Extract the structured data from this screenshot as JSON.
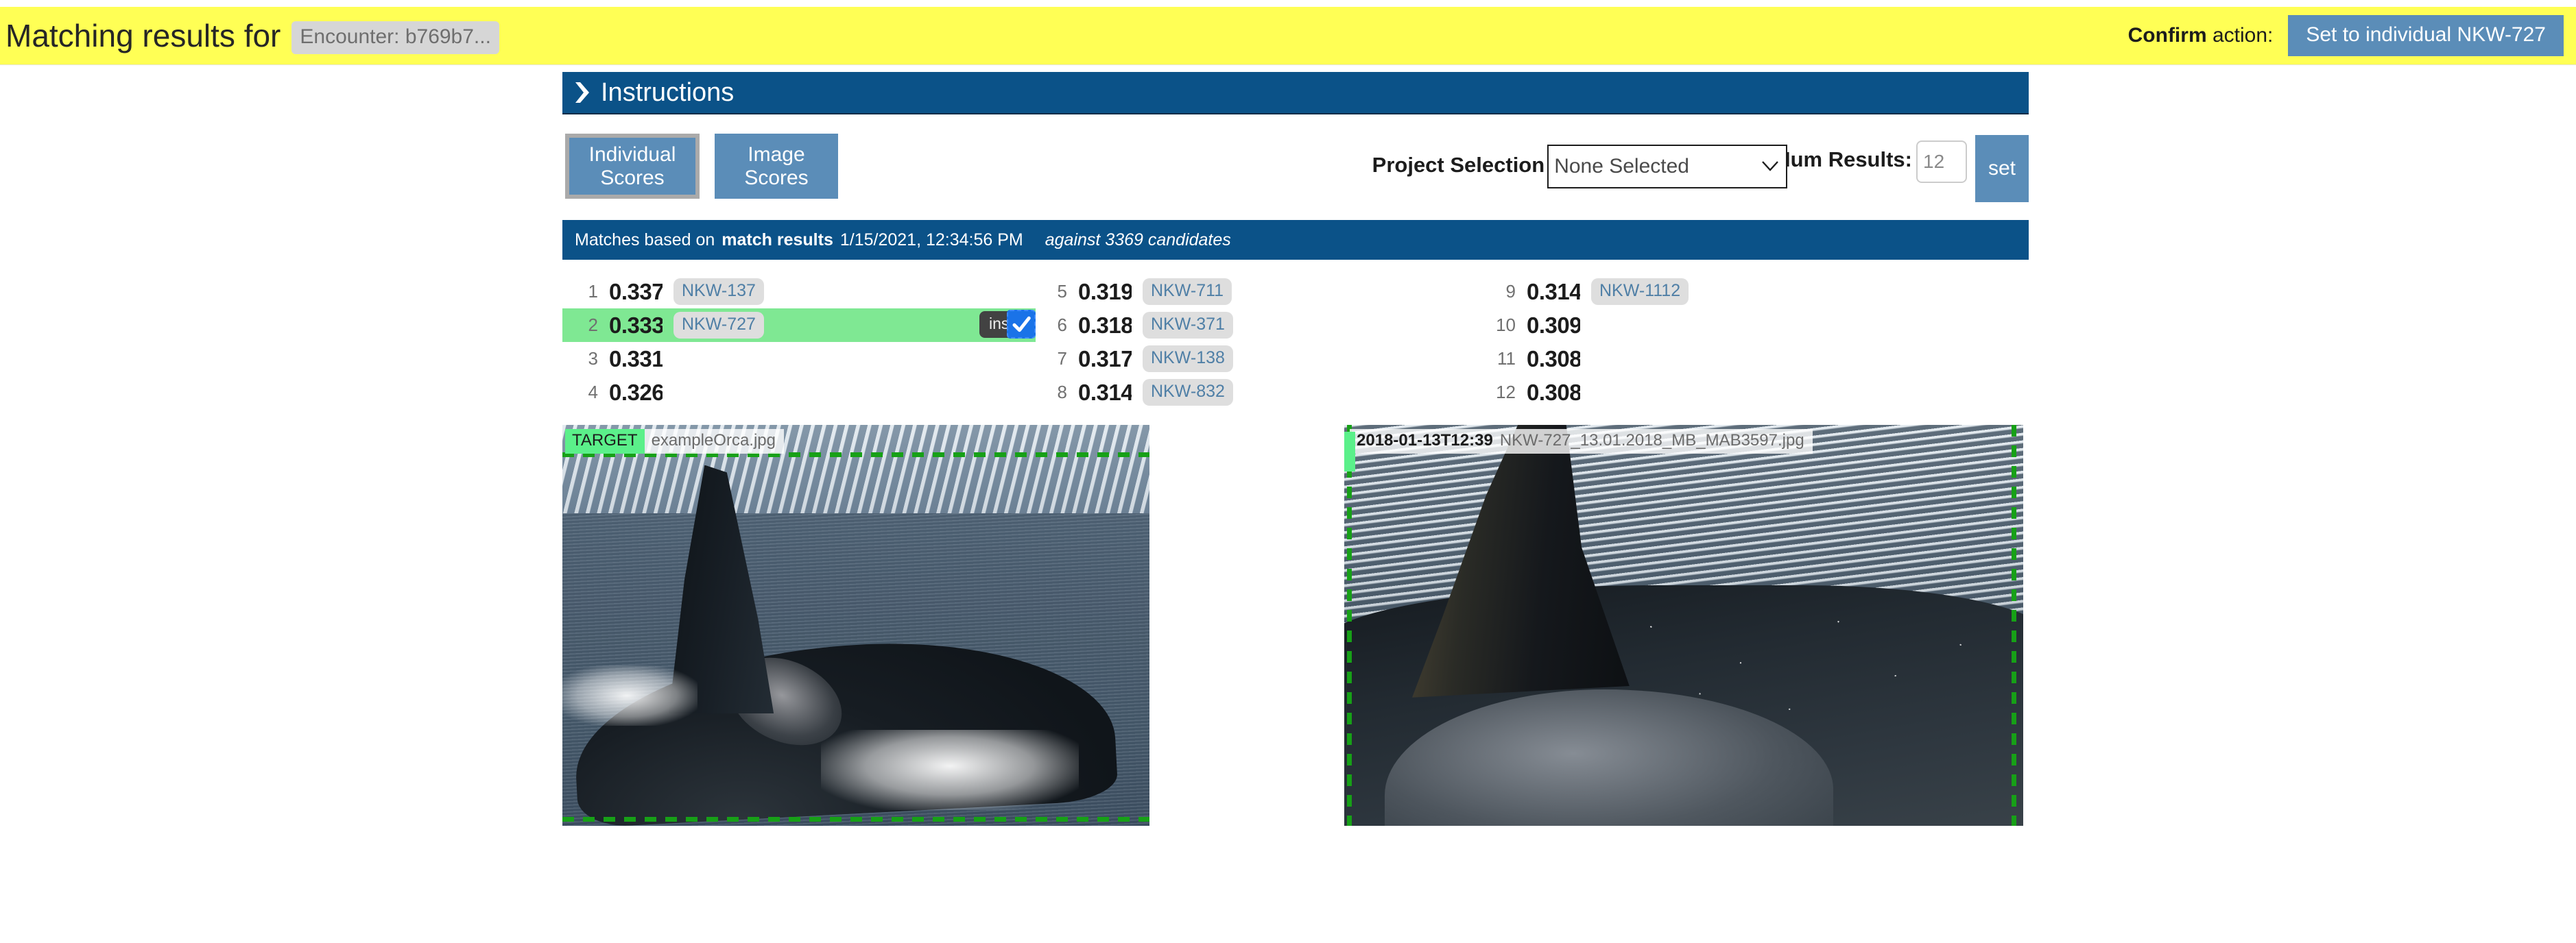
{
  "confirm_bar": {
    "title": "Matching results for",
    "encounter_chip": "Encounter: b769b7...",
    "confirm_bold": "Confirm",
    "confirm_rest": " action:",
    "set_individual_label": "Set to individual NKW-727"
  },
  "instructions": {
    "label": "Instructions",
    "chevron_icon": "chevron-right-icon"
  },
  "controls": {
    "tab_individual_scores": "Individual Scores",
    "tab_image_scores": "Image Scores",
    "project_selection_label": "Project Selection",
    "project_selected_value": "None Selected",
    "project_options": [
      "None Selected"
    ],
    "dropdown_icon": "chevron-down-icon",
    "num_results_label": "Num Results:",
    "num_results_value": "12",
    "num_results_placeholder": "12",
    "set_button_label": "set"
  },
  "matches_bar": {
    "prefix": "Matches based on",
    "basis": "match results",
    "timestamp": "1/15/2021, 12:34:56 PM",
    "candidates": "against 3369 candidates"
  },
  "results": {
    "rows": [
      {
        "rank": "1",
        "score": "0.33766",
        "id": "NKW-137",
        "highlight": false
      },
      {
        "rank": "2",
        "score": "0.33355",
        "id": "NKW-727",
        "highlight": true
      },
      {
        "rank": "3",
        "score": "0.33156",
        "id": "",
        "highlight": false
      },
      {
        "rank": "4",
        "score": "0.32644",
        "id": "",
        "highlight": false
      },
      {
        "rank": "5",
        "score": "0.31966",
        "id": "NKW-711",
        "highlight": false
      },
      {
        "rank": "6",
        "score": "0.31800",
        "id": "NKW-371",
        "highlight": false
      },
      {
        "rank": "7",
        "score": "0.31744",
        "id": "NKW-138",
        "highlight": false
      },
      {
        "rank": "8",
        "score": "0.31455",
        "id": "NKW-832",
        "highlight": false
      },
      {
        "rank": "9",
        "score": "0.31400",
        "id": "NKW-1112",
        "highlight": false
      },
      {
        "rank": "10",
        "score": "0.30995",
        "id": "",
        "highlight": false
      },
      {
        "rank": "11",
        "score": "0.30888",
        "id": "",
        "highlight": false
      },
      {
        "rank": "12",
        "score": "0.30811",
        "id": "",
        "highlight": false
      }
    ],
    "inspect_tooltip": "inspect",
    "cursor_icon": "checkmark-cursor-icon"
  },
  "images": {
    "target": {
      "badge": "TARGET",
      "filename": "exampleOrca.jpg",
      "annotation_icon": "green-dashed-box"
    },
    "match": {
      "date": "2018-01-13T12:39",
      "filename": "NKW-727_13.01.2018_MB_MAB3597.jpg",
      "annotation_icon": "green-dashed-box"
    }
  },
  "colors": {
    "warning_bar": "#ffff55",
    "header_blue": "#0b5288",
    "button_blue": "#5b8db8",
    "highlight_green": "#7fe893",
    "badge_green": "#5bf08a",
    "annotation_green": "#17a017",
    "cursor_blue": "#1a73e8"
  }
}
